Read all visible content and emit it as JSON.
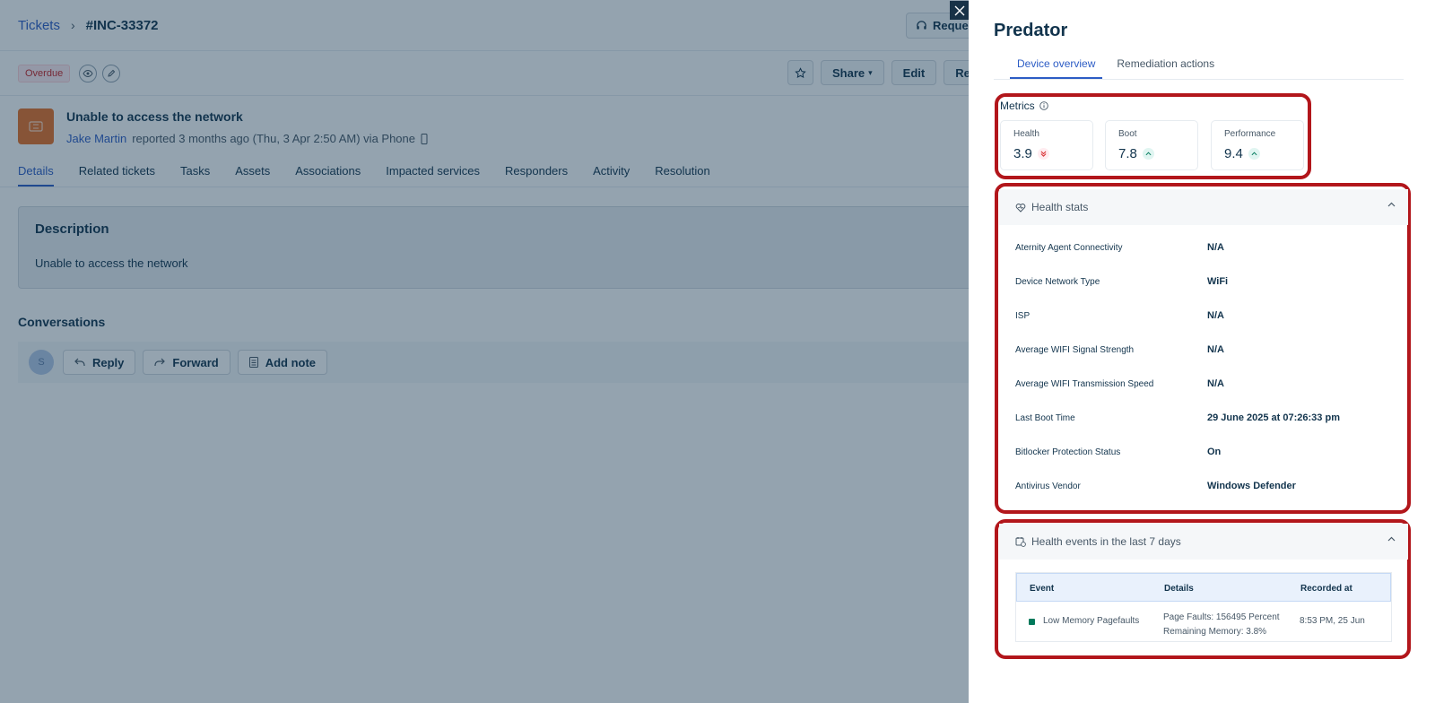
{
  "breadcrumb": {
    "root": "Tickets",
    "ticket_id": "#INC-33372"
  },
  "header_button": {
    "label": "Reque"
  },
  "status_badge": "Overdue",
  "actions": {
    "share": "Share",
    "edit": "Edit",
    "more": "Re"
  },
  "ticket": {
    "title": "Unable to access the network",
    "requester": "Jake Martin",
    "meta": "reported 3 months ago (Thu, 3 Apr 2:50 AM) via Phone"
  },
  "tabs": [
    "Details",
    "Related tickets",
    "Tasks",
    "Assets",
    "Associations",
    "Impacted services",
    "Responders",
    "Activity",
    "Resolution"
  ],
  "description": {
    "title": "Description",
    "text": "Unable to access the network"
  },
  "conversations": {
    "title": "Conversations",
    "avatar": "S",
    "reply": "Reply",
    "forward": "Forward",
    "add_note": "Add note"
  },
  "panel": {
    "title": "Predator",
    "tabs": {
      "device_overview": "Device overview",
      "remediation": "Remediation actions"
    },
    "metrics_label": "Metrics",
    "metrics": [
      {
        "label": "Health",
        "value": "3.9",
        "trend": "down"
      },
      {
        "label": "Boot",
        "value": "7.8",
        "trend": "up"
      },
      {
        "label": "Performance",
        "value": "9.4",
        "trend": "up"
      }
    ],
    "health_stats": {
      "title": "Health stats",
      "rows": [
        {
          "key": "Aternity Agent Connectivity",
          "value": "N/A"
        },
        {
          "key": "Device Network Type",
          "value": "WiFi"
        },
        {
          "key": "ISP",
          "value": "N/A"
        },
        {
          "key": "Average WIFI Signal Strength",
          "value": "N/A"
        },
        {
          "key": "Average WIFI Transmission Speed",
          "value": "N/A"
        },
        {
          "key": "Last Boot Time",
          "value": "29 June 2025 at 07:26:33 pm"
        },
        {
          "key": "Bitlocker Protection Status",
          "value": "On"
        },
        {
          "key": "Antivirus Vendor",
          "value": "Windows Defender"
        }
      ]
    },
    "health_events": {
      "title": "Health events in the last 7 days",
      "columns": [
        "Event",
        "Details",
        "Recorded at"
      ],
      "rows": [
        {
          "event": "Low Memory Pagefaults",
          "details": "Page Faults: 156495 Percent Remaining Memory: 3.8%",
          "recorded": "8:53 PM, 25 Jun"
        }
      ]
    }
  },
  "colors": {
    "accent": "#2c5cc5",
    "highlight": "#b2161b",
    "ticket_icon": "#e86f25"
  }
}
